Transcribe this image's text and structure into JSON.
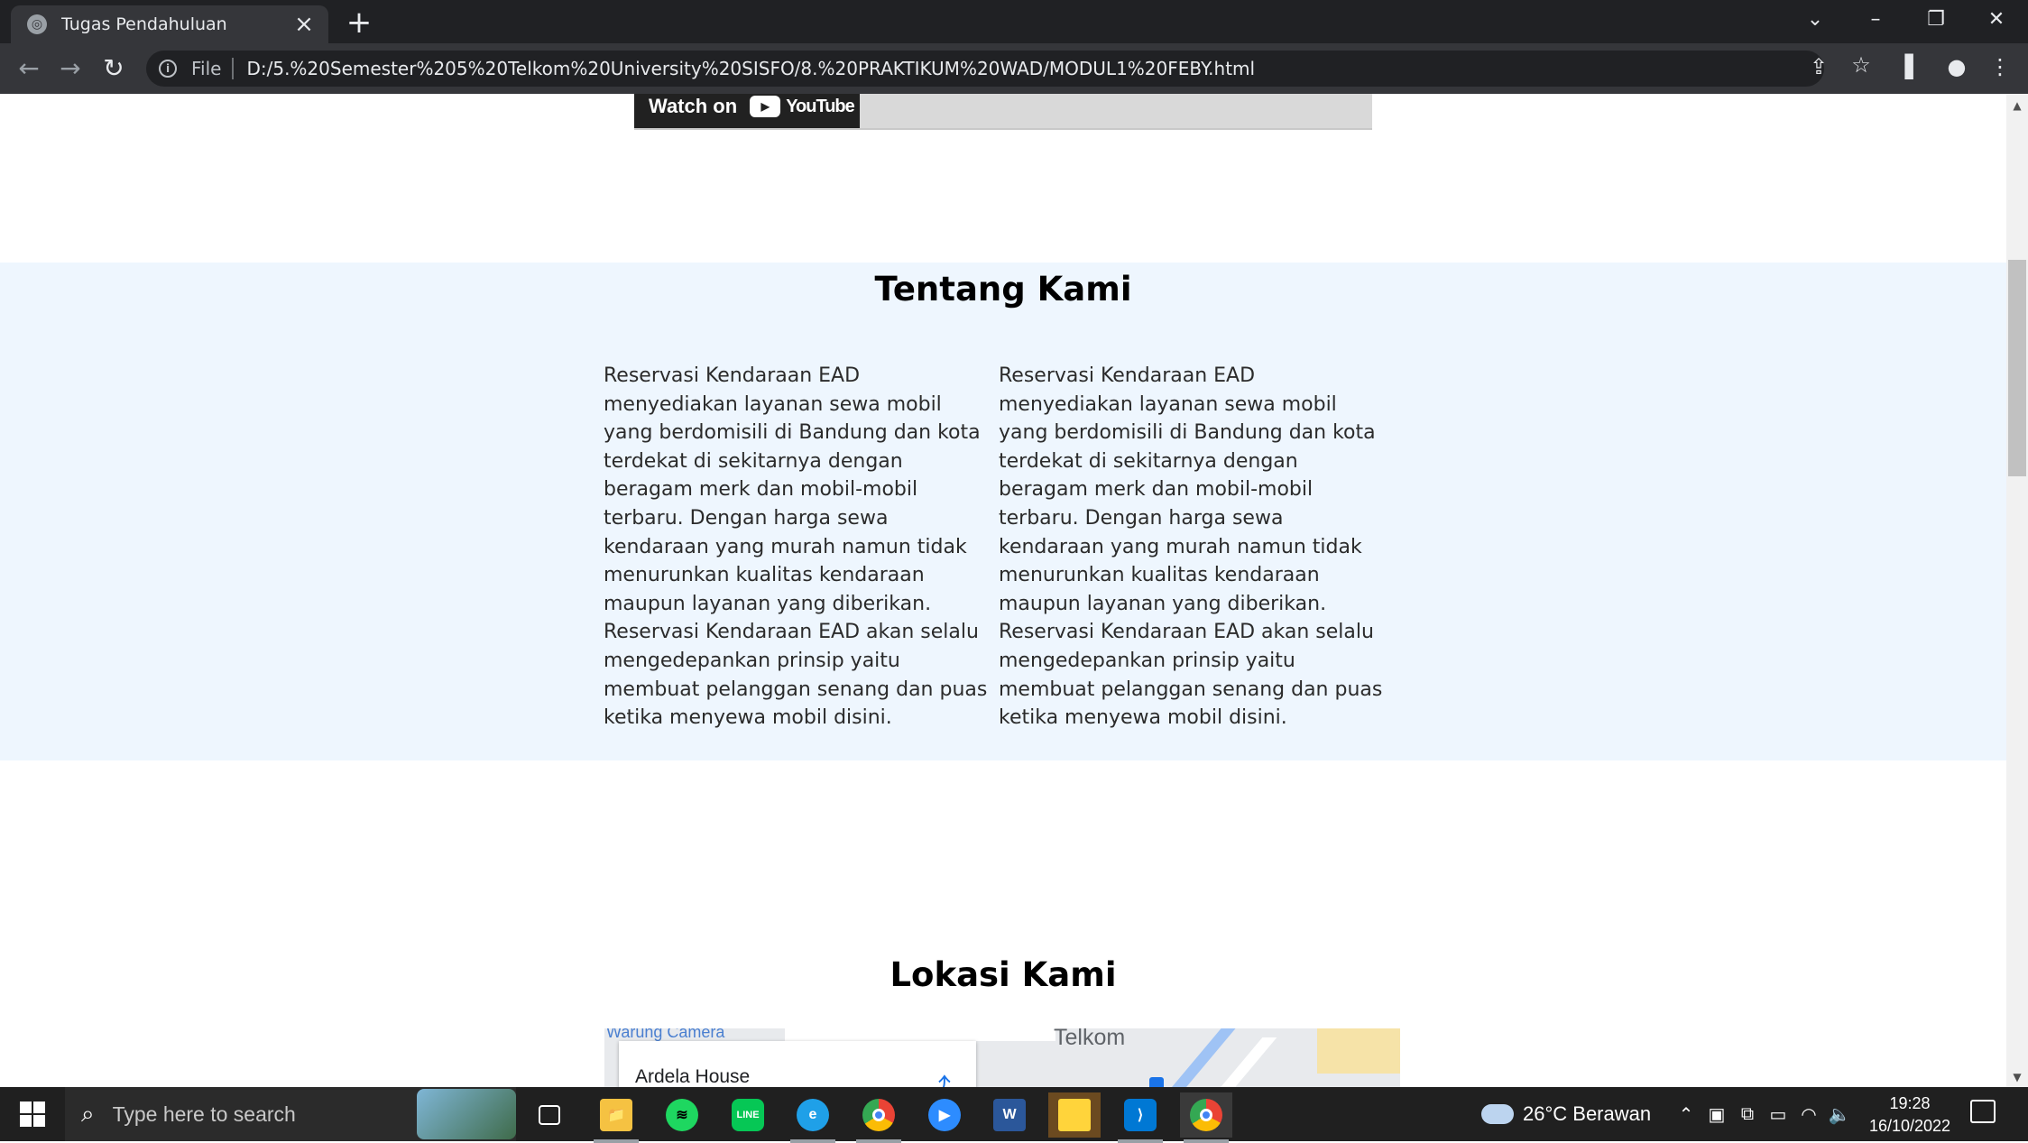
{
  "browser": {
    "tab_title": "Tugas Pendahuluan",
    "new_tab_symbol": "+",
    "close_tab_symbol": "×",
    "url_scheme_label": "File",
    "url": "D:/5.%20Semester%205%20Telkom%20University%20SISFO/8.%20PRAKTIKUM%20WAD/MODUL1%20FEBY.html"
  },
  "page": {
    "video": {
      "watch_on": "Watch on",
      "youtube": "YouTube"
    },
    "about": {
      "title": "Tentang Kami",
      "col1": "Reservasi Kendaraan EAD menyediakan layanan sewa mobil yang berdomisili di Bandung dan kota terdekat di sekitarnya dengan beragam merk dan mobil-mobil terbaru. Dengan harga sewa kendaraan yang murah namun tidak menurunkan kualitas kendaraan maupun layanan yang diberikan. Reservasi Kendaraan EAD akan selalu mengedepankan prinsip yaitu membuat pelanggan senang dan puas ketika menyewa mobil disini.",
      "col2": "Reservasi Kendaraan EAD menyediakan layanan sewa mobil yang berdomisili di Bandung dan kota terdekat di sekitarnya dengan beragam merk dan mobil-mobil terbaru. Dengan harga sewa kendaraan yang murah namun tidak menurunkan kualitas kendaraan maupun layanan yang diberikan. Reservasi Kendaraan EAD akan selalu mengedepankan prinsip yaitu membuat pelanggan senang dan puas ketika menyewa mobil disini."
    },
    "location": {
      "title": "Lokasi Kami",
      "map_place": "Ardela House",
      "map_label_warung": "Warung Camera",
      "map_label_telkom": "Telkom"
    }
  },
  "taskbar": {
    "search_placeholder": "Type here to search",
    "apps": [
      "task-view",
      "file-explorer",
      "spotify",
      "line",
      "edge",
      "chrome",
      "zoom",
      "word",
      "sticky-notes",
      "vscode",
      "chrome-active"
    ],
    "weather": "26°C  Berawan",
    "time": "19:28",
    "date": "16/10/2022"
  },
  "colors": {
    "about_bg": "#eef6fe",
    "tab_bar": "#202124",
    "toolbar": "#35363a",
    "taskbar": "#202020"
  }
}
